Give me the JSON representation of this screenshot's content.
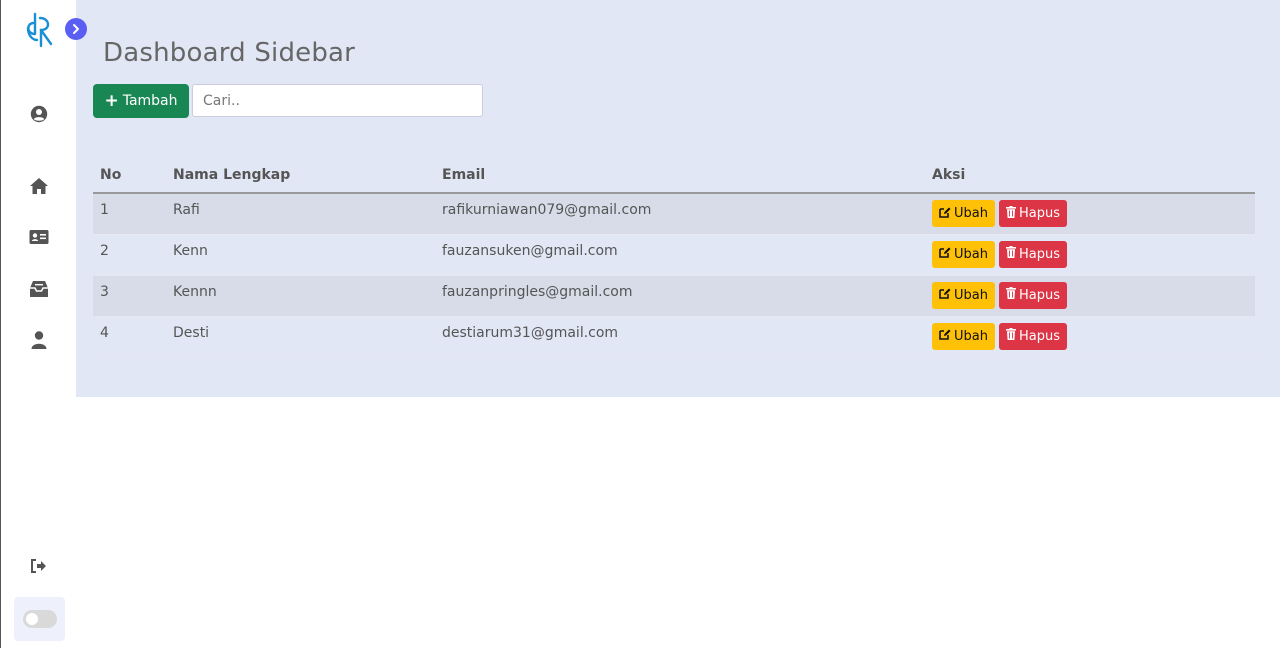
{
  "sidebar": {
    "logo_icon": "dpr-logo-icon",
    "toggle_icon": "chevron-right-icon",
    "accent_color": "#5a5ef2",
    "items": [
      {
        "icon": "user-circle-icon"
      },
      {
        "icon": "home-icon"
      },
      {
        "icon": "id-card-icon"
      },
      {
        "icon": "inbox-icon"
      },
      {
        "icon": "user-icon"
      }
    ],
    "logout_icon": "logout-icon",
    "theme_toggle": "off"
  },
  "main": {
    "title": "Dashboard Sidebar",
    "add_button_label": "Tambah",
    "add_button_color": "#198754",
    "search_placeholder": "Cari..",
    "table": {
      "headers": [
        "No",
        "Nama Lengkap",
        "Email",
        "Aksi"
      ],
      "rows": [
        {
          "no": "1",
          "nama": "Rafi",
          "email": "rafikurniawan079@gmail.com"
        },
        {
          "no": "2",
          "nama": "Kenn",
          "email": "fauzansuken@gmail.com"
        },
        {
          "no": "3",
          "nama": "Kennn",
          "email": "fauzanpringles@gmail.com"
        },
        {
          "no": "4",
          "nama": "Desti",
          "email": "destiarum31@gmail.com"
        }
      ],
      "edit_label": "Ubah",
      "delete_label": "Hapus",
      "edit_color": "#ffc107",
      "delete_color": "#dc3545"
    }
  }
}
